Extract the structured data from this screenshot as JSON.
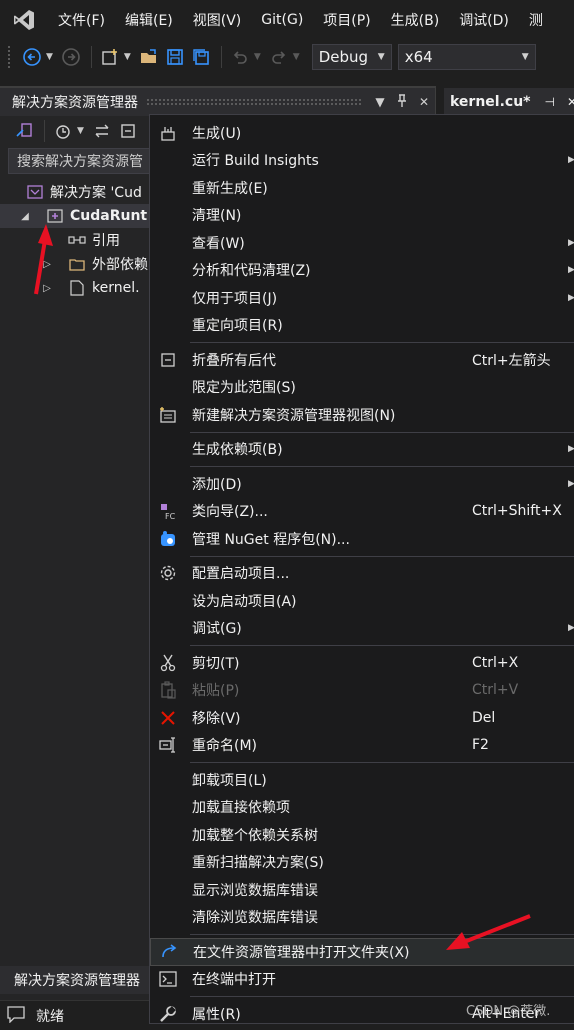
{
  "menubar": {
    "items": [
      "文件(F)",
      "编辑(E)",
      "视图(V)",
      "Git(G)",
      "项目(P)",
      "生成(B)",
      "调试(D)",
      "测"
    ]
  },
  "toolbar": {
    "config": "Debug",
    "platform": "x64"
  },
  "solution_explorer": {
    "title": "解决方案资源管理器",
    "search_placeholder": "搜索解决方案资源管",
    "tree": [
      {
        "label": "解决方案 'Cud",
        "level": 0
      },
      {
        "label": "CudaRunt",
        "level": 0,
        "bold": true
      },
      {
        "label": "引用",
        "level": 1
      },
      {
        "label": "外部依赖",
        "level": 1
      },
      {
        "label": "kernel.",
        "level": 1
      }
    ],
    "bottom_tab": "解决方案资源管理器"
  },
  "editor_tab": {
    "title": "kernel.cu*"
  },
  "statusbar": {
    "text": "就绪"
  },
  "context_menu": {
    "groups": [
      [
        {
          "label": "生成(U)",
          "icon": "build-icon"
        },
        {
          "label": "运行 Build Insights",
          "submenu": true
        },
        {
          "label": "重新生成(E)"
        },
        {
          "label": "清理(N)"
        },
        {
          "label": "查看(W)",
          "submenu": true
        },
        {
          "label": "分析和代码清理(Z)",
          "submenu": true
        },
        {
          "label": "仅用于项目(J)",
          "submenu": true
        },
        {
          "label": "重定向项目(R)"
        }
      ],
      [
        {
          "label": "折叠所有后代",
          "shortcut": "Ctrl+左箭头",
          "icon": "collapse-icon"
        },
        {
          "label": "限定为此范围(S)"
        },
        {
          "label": "新建解决方案资源管理器视图(N)",
          "icon": "new-view-icon"
        }
      ],
      [
        {
          "label": "生成依赖项(B)",
          "submenu": true
        }
      ],
      [
        {
          "label": "添加(D)",
          "submenu": true
        },
        {
          "label": "类向导(Z)...",
          "shortcut": "Ctrl+Shift+X",
          "icon": "class-wizard-icon"
        },
        {
          "label": "管理 NuGet 程序包(N)...",
          "icon": "nuget-icon"
        }
      ],
      [
        {
          "label": "配置启动项目...",
          "icon": "gear-icon"
        },
        {
          "label": "设为启动项目(A)"
        },
        {
          "label": "调试(G)",
          "submenu": true
        }
      ],
      [
        {
          "label": "剪切(T)",
          "shortcut": "Ctrl+X",
          "icon": "cut-icon"
        },
        {
          "label": "粘贴(P)",
          "shortcut": "Ctrl+V",
          "icon": "paste-icon",
          "disabled": true
        },
        {
          "label": "移除(V)",
          "shortcut": "Del",
          "icon": "remove-icon"
        },
        {
          "label": "重命名(M)",
          "shortcut": "F2",
          "icon": "rename-icon"
        }
      ],
      [
        {
          "label": "卸载项目(L)"
        },
        {
          "label": "加载直接依赖项"
        },
        {
          "label": "加载整个依赖关系树"
        },
        {
          "label": "重新扫描解决方案(S)"
        },
        {
          "label": "显示浏览数据库错误"
        },
        {
          "label": "清除浏览数据库错误"
        }
      ],
      [
        {
          "label": "在文件资源管理器中打开文件夹(X)",
          "icon": "open-folder-arrow-icon",
          "highlighted": true
        },
        {
          "label": "在终端中打开",
          "icon": "terminal-icon"
        }
      ],
      [
        {
          "label": "属性(R)",
          "shortcut": "Alt+Enter",
          "icon": "wrench-icon"
        }
      ]
    ]
  },
  "watermark": "CSDN @莘微.",
  "colors": {
    "accent": "#e81123",
    "bg": "#1f1f1f",
    "menu_bg": "#1b1b1c"
  }
}
